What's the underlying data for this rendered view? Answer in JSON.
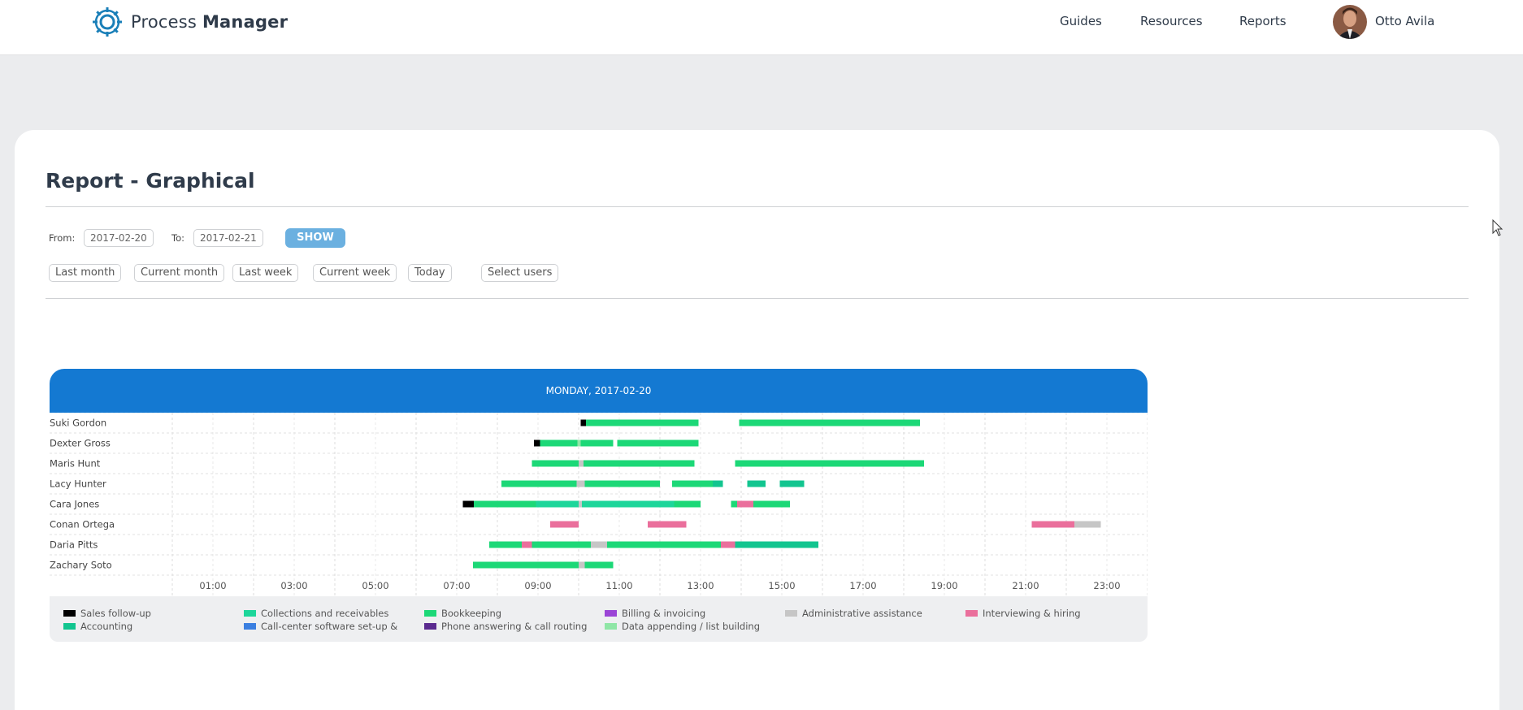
{
  "brand": {
    "name_regular": "Process ",
    "name_bold": "Manager"
  },
  "nav": {
    "links": [
      "Guides",
      "Resources",
      "Reports"
    ],
    "user_name": "Otto Avila"
  },
  "page": {
    "title": "Report - Graphical",
    "from_label": "From:",
    "from_value": "2017-02-20",
    "to_label": "To:",
    "to_value": "2017-02-21",
    "show_label": "SHOW",
    "quick_ranges": [
      "Last month",
      "Current month",
      "Last week",
      "Current week",
      "Today"
    ],
    "select_users_label": "Select users"
  },
  "colors": {
    "header_blue": "#1479d2",
    "show_button": "#6bb0e0",
    "sales_follow_up": "#000000",
    "collections": "#1dd69a",
    "bookkeeping": "#1cd877",
    "billing": "#9b45d6",
    "admin_assistance": "#c6c6c6",
    "interviewing": "#ea6f9c",
    "accounting": "#12c58f",
    "call_center": "#3b7fe0",
    "phone_answering": "#5a2a8f",
    "data_appending": "#8fe6a6"
  },
  "chart_data": {
    "type": "timeline",
    "title": "MONDAY, 2017-02-20",
    "x_range_hours": [
      0,
      24
    ],
    "x_ticks": [
      "01:00",
      "03:00",
      "05:00",
      "07:00",
      "09:00",
      "11:00",
      "13:00",
      "15:00",
      "17:00",
      "19:00",
      "21:00",
      "23:00"
    ],
    "rows": [
      {
        "name": "Suki Gordon",
        "segments": [
          {
            "start": 10.05,
            "end": 10.18,
            "category": "sales_follow_up"
          },
          {
            "start": 10.18,
            "end": 12.95,
            "category": "bookkeeping"
          },
          {
            "start": 13.95,
            "end": 18.4,
            "category": "bookkeeping"
          }
        ]
      },
      {
        "name": "Dexter Gross",
        "segments": [
          {
            "start": 8.9,
            "end": 9.05,
            "category": "sales_follow_up"
          },
          {
            "start": 9.05,
            "end": 9.97,
            "category": "bookkeeping"
          },
          {
            "start": 9.97,
            "end": 10.05,
            "category": "data_appending"
          },
          {
            "start": 10.05,
            "end": 10.85,
            "category": "bookkeeping"
          },
          {
            "start": 10.95,
            "end": 12.95,
            "category": "bookkeeping"
          }
        ]
      },
      {
        "name": "Maris Hunt",
        "segments": [
          {
            "start": 8.85,
            "end": 10.0,
            "category": "bookkeeping"
          },
          {
            "start": 10.0,
            "end": 10.12,
            "category": "admin_assistance"
          },
          {
            "start": 10.12,
            "end": 12.85,
            "category": "bookkeeping"
          },
          {
            "start": 13.85,
            "end": 18.5,
            "category": "bookkeeping"
          }
        ]
      },
      {
        "name": "Lacy Hunter",
        "segments": [
          {
            "start": 8.1,
            "end": 9.95,
            "category": "bookkeeping"
          },
          {
            "start": 9.95,
            "end": 10.15,
            "category": "admin_assistance"
          },
          {
            "start": 10.15,
            "end": 12.0,
            "category": "bookkeeping"
          },
          {
            "start": 12.3,
            "end": 13.3,
            "category": "bookkeeping"
          },
          {
            "start": 13.3,
            "end": 13.55,
            "category": "accounting"
          },
          {
            "start": 14.15,
            "end": 14.6,
            "category": "accounting"
          },
          {
            "start": 14.95,
            "end": 15.55,
            "category": "accounting"
          }
        ]
      },
      {
        "name": "Cara Jones",
        "segments": [
          {
            "start": 7.15,
            "end": 7.42,
            "category": "sales_follow_up"
          },
          {
            "start": 7.42,
            "end": 8.95,
            "category": "bookkeeping"
          },
          {
            "start": 8.95,
            "end": 10.0,
            "category": "collections"
          },
          {
            "start": 10.0,
            "end": 10.08,
            "category": "admin_assistance"
          },
          {
            "start": 10.08,
            "end": 12.35,
            "category": "collections"
          },
          {
            "start": 12.35,
            "end": 13.0,
            "category": "bookkeeping"
          },
          {
            "start": 13.75,
            "end": 13.9,
            "category": "bookkeeping"
          },
          {
            "start": 13.9,
            "end": 14.3,
            "category": "interviewing"
          },
          {
            "start": 14.3,
            "end": 15.2,
            "category": "bookkeeping"
          }
        ]
      },
      {
        "name": "Conan Ortega",
        "segments": [
          {
            "start": 9.3,
            "end": 10.0,
            "category": "interviewing"
          },
          {
            "start": 11.7,
            "end": 12.65,
            "category": "interviewing"
          },
          {
            "start": 21.15,
            "end": 22.2,
            "category": "interviewing"
          },
          {
            "start": 22.2,
            "end": 22.85,
            "category": "admin_assistance"
          }
        ]
      },
      {
        "name": "Daria Pitts",
        "segments": [
          {
            "start": 7.8,
            "end": 8.6,
            "category": "bookkeeping"
          },
          {
            "start": 8.6,
            "end": 8.85,
            "category": "interviewing"
          },
          {
            "start": 8.85,
            "end": 10.0,
            "category": "bookkeeping"
          },
          {
            "start": 10.0,
            "end": 10.3,
            "category": "bookkeeping"
          },
          {
            "start": 10.3,
            "end": 10.7,
            "category": "admin_assistance"
          },
          {
            "start": 10.7,
            "end": 13.5,
            "category": "bookkeeping"
          },
          {
            "start": 13.5,
            "end": 13.85,
            "category": "interviewing"
          },
          {
            "start": 13.85,
            "end": 15.9,
            "category": "accounting"
          }
        ]
      },
      {
        "name": "Zachary Soto",
        "segments": [
          {
            "start": 7.4,
            "end": 10.0,
            "category": "bookkeeping"
          },
          {
            "start": 10.0,
            "end": 10.15,
            "category": "admin_assistance"
          },
          {
            "start": 10.15,
            "end": 10.85,
            "category": "bookkeeping"
          }
        ]
      }
    ],
    "legend": [
      {
        "key": "sales_follow_up",
        "label": "Sales follow-up"
      },
      {
        "key": "collections",
        "label": "Collections and receivables"
      },
      {
        "key": "bookkeeping",
        "label": "Bookkeeping"
      },
      {
        "key": "billing",
        "label": "Billing & invoicing"
      },
      {
        "key": "admin_assistance",
        "label": "Administrative assistance"
      },
      {
        "key": "interviewing",
        "label": "Interviewing & hiring"
      },
      {
        "key": "accounting",
        "label": "Accounting"
      },
      {
        "key": "call_center",
        "label": "Call-center software set-up &"
      },
      {
        "key": "phone_answering",
        "label": "Phone answering & call routing"
      },
      {
        "key": "data_appending",
        "label": "Data appending / list building"
      }
    ]
  }
}
